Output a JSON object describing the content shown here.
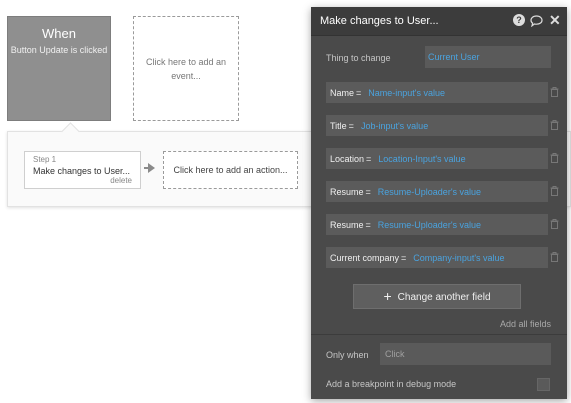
{
  "when": {
    "title": "When",
    "event": "Button Update is clicked"
  },
  "add_event": "Click here to add an event...",
  "step": {
    "label": "Step 1",
    "name": "Make changes to User...",
    "delete": "delete"
  },
  "add_action": "Click here to add an action...",
  "panel": {
    "title": "Make changes to User...",
    "icons": [
      "help-icon",
      "comment-icon",
      "close-icon"
    ],
    "thing_label": "Thing to change",
    "thing_value": "Current User",
    "fields": [
      {
        "key": "Name",
        "value": "Name-input's value"
      },
      {
        "key": "Title",
        "value": "Job-input's value"
      },
      {
        "key": "Location",
        "value": "Location-Input's value"
      },
      {
        "key": "Resume",
        "value": "Resume-Uploader's value"
      },
      {
        "key": "Resume",
        "value": "Resume-Uploader's value"
      },
      {
        "key": "Current company",
        "value": "Company-input's value"
      }
    ],
    "eq": "=",
    "change_button": "Change another field",
    "add_all": "Add all fields",
    "only_when_label": "Only when",
    "only_when_placeholder": "Click",
    "breakpoint_label": "Add a breakpoint in debug mode"
  },
  "colors": {
    "accent": "#4aa3df",
    "panel_bg": "#4a4a4a",
    "when_bg": "#8f8f8f"
  }
}
